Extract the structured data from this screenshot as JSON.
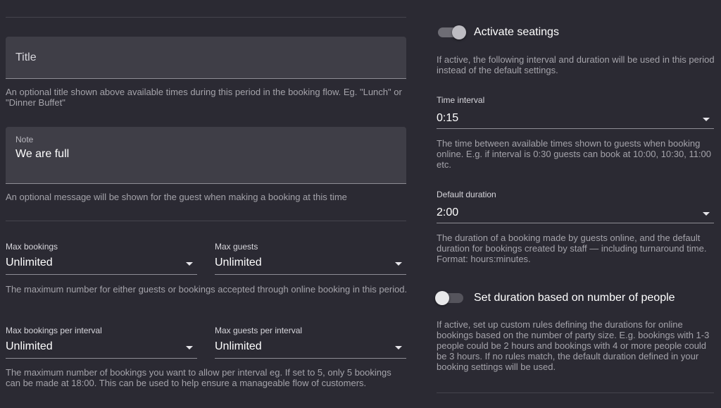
{
  "left": {
    "title_field": {
      "placeholder": "Title",
      "helper": "An optional title shown above available times during this period in the booking flow. Eg. \"Lunch\" or \"Dinner Buffet\""
    },
    "note_field": {
      "label": "Note",
      "value": "We are full",
      "helper": "An optional message will be shown for the guest when making a booking at this time"
    },
    "max_bookings": {
      "label": "Max bookings",
      "value": "Unlimited"
    },
    "max_guests": {
      "label": "Max guests",
      "value": "Unlimited"
    },
    "max_helper": "The maximum number for either guests or bookings accepted through online booking in this period.",
    "max_bookings_interval": {
      "label": "Max bookings per interval",
      "value": "Unlimited"
    },
    "max_guests_interval": {
      "label": "Max guests per interval",
      "value": "Unlimited"
    },
    "interval_helper": "The maximum number of bookings you want to allow per interval eg. If set to 5, only 5 bookings can be made at 18:00. This can be used to help ensure a manageable flow of customers."
  },
  "right": {
    "activate_seatings": {
      "label": "Activate seatings",
      "state": "on",
      "helper": "If active, the following interval and duration will be used in this period instead of the default settings."
    },
    "time_interval": {
      "label": "Time interval",
      "value": "0:15",
      "helper": "The time between available times shown to guests when booking online. E.g. if interval is 0:30 guests can book at 10:00, 10:30, 11:00 etc."
    },
    "default_duration": {
      "label": "Default duration",
      "value": "2:00",
      "helper": "The duration of a booking made by guests online, and the default duration for bookings created by staff — including turnaround time. Format: hours:minutes."
    },
    "duration_by_people": {
      "label": "Set duration based on number of people",
      "state": "off",
      "helper": "If active, set up custom rules defining the durations for online bookings based on the number of party size. E.g. bookings with 1-3 people could be 2 hours and bookings with 4 or more people could be 3 hours. If no rules match, the default duration defined in your booking settings will be used."
    }
  },
  "colors": {
    "background": "#2b2a33",
    "field_fill": "#3f3e47",
    "helper_text": "#a4a3aa",
    "divider": "#45444d"
  }
}
